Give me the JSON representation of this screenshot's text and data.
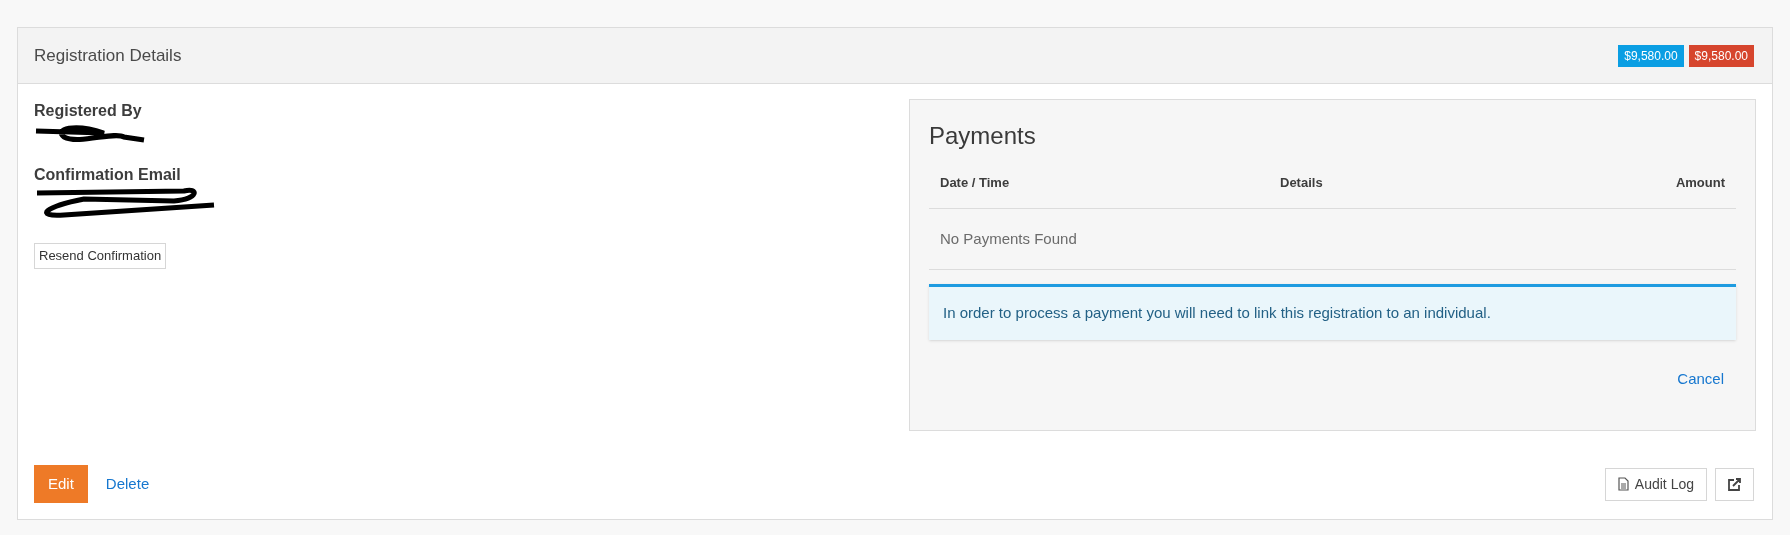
{
  "panel": {
    "title": "Registration Details",
    "badges": [
      {
        "text": "$9,580.00",
        "color": "#0a9ee3"
      },
      {
        "text": "$9,580.00",
        "color": "#d6452d"
      }
    ]
  },
  "details": [
    {
      "label": "Registered By",
      "kind": "link"
    },
    {
      "label": "Confirmation Email",
      "kind": "text"
    }
  ],
  "resend_button": "Resend Confirmation",
  "payments": {
    "title": "Payments",
    "columns": [
      "Date / Time",
      "Details",
      "Amount"
    ],
    "empty": "No Payments Found",
    "alert": "In order to process a payment you will need to link this registration to an individual.",
    "cancel": "Cancel"
  },
  "footer": {
    "edit": "Edit",
    "delete": "Delete",
    "audit_log": "Audit Log"
  }
}
